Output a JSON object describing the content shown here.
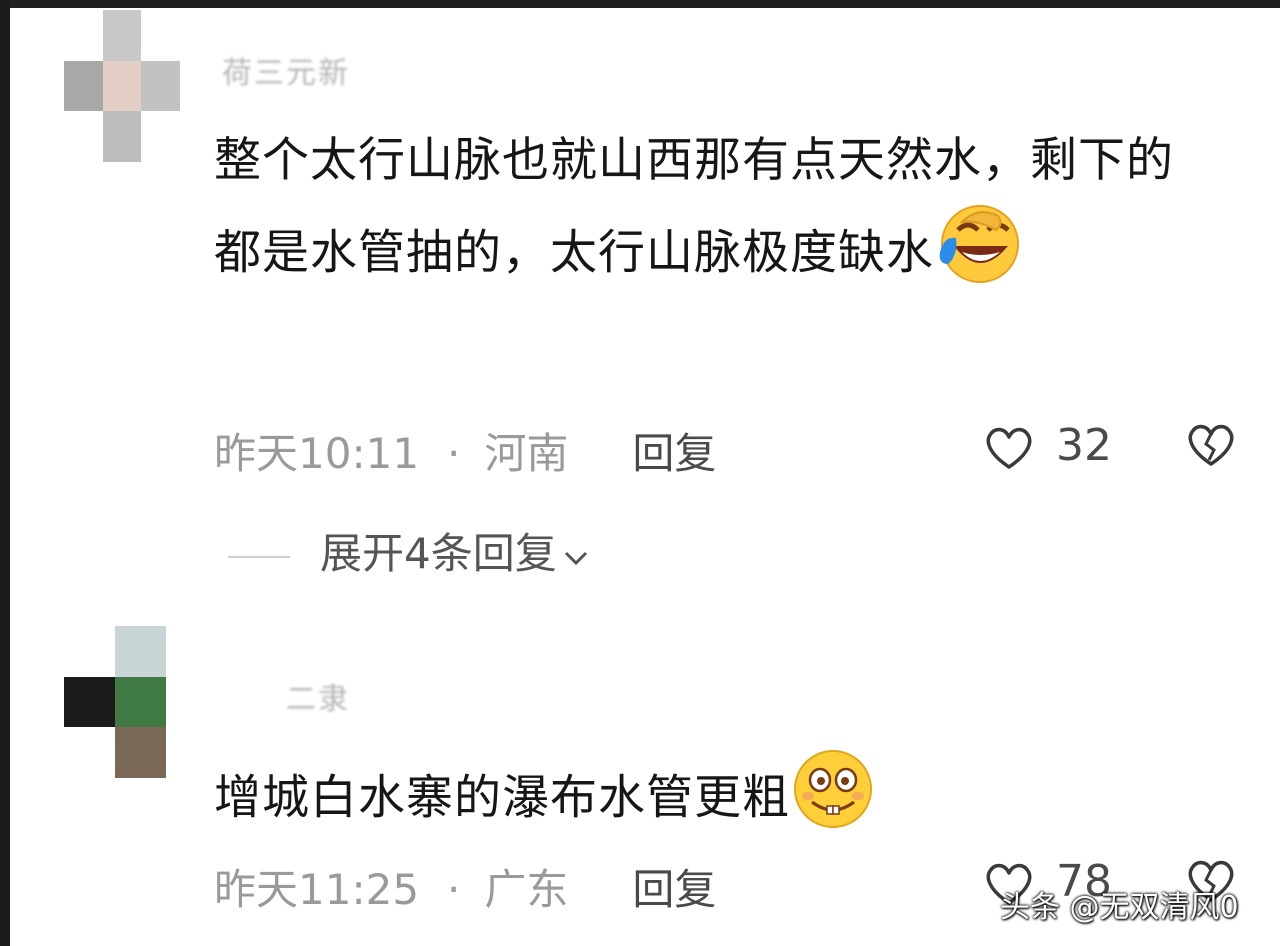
{
  "comments": [
    {
      "username": "荷三元新",
      "text": "整个太行山脉也就山西那有点天然水，剩下的都是水管抽的，太行山脉极度缺水",
      "emoji_icon": "laugh-cry-emoji",
      "time": "昨天10:11",
      "separator": "·",
      "region": "河南",
      "reply_label": "回复",
      "like_count": "32",
      "expand_label": "展开4条回复"
    },
    {
      "username": "二隶",
      "text": "增城白水寨的瀑布水管更粗",
      "emoji_icon": "grin-emoji",
      "time": "昨天11:25",
      "separator": "·",
      "region": "广东",
      "reply_label": "回复",
      "like_count": "78"
    }
  ],
  "watermark": "头条 @无双清风0",
  "colors": {
    "text": "#161616",
    "meta": "#9a9a9a",
    "background": "#ffffff"
  }
}
